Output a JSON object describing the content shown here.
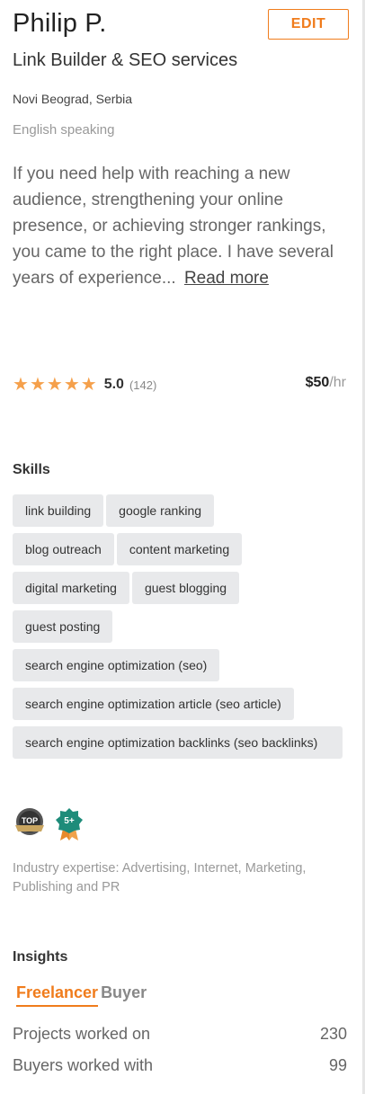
{
  "profile": {
    "name": "Philip P.",
    "edit_label": "EDIT",
    "headline": "Link Builder & SEO services",
    "location": "Novi Beograd, Serbia",
    "language": "English speaking",
    "bio": "If you need help with reaching a new audience, strengthening your online presence, or achieving stronger rankings, you came to the right place. I have several years of experience...",
    "read_more": "Read more",
    "stars": 5,
    "rating": "5.0",
    "reviews": "(142)",
    "rate": "$50",
    "rate_unit": "/hr"
  },
  "skills": {
    "title": "Skills",
    "items": [
      "link building",
      "google ranking",
      "blog outreach",
      "content marketing",
      "digital marketing",
      "guest blogging",
      "guest posting",
      "search engine optimization (seo)",
      "search engine optimization article (seo article)",
      "search engine optimization backlinks (seo backlinks)"
    ]
  },
  "badges": {
    "top": "TOP",
    "level": "5+",
    "icons": [
      "top-badge-icon",
      "level-badge-icon"
    ]
  },
  "industry": "Industry expertise: Advertising, Internet, Marketing, Publishing and PR",
  "insights": {
    "title": "Insights",
    "tabs": [
      "Freelancer",
      "Buyer"
    ],
    "stats": [
      {
        "label": "Projects worked on",
        "value": "230"
      },
      {
        "label": "Buyers worked with",
        "value": "99"
      }
    ]
  },
  "colors": {
    "accent": "#f07c1c",
    "star": "#f5a04b",
    "chip_bg": "#e8e9eb"
  }
}
